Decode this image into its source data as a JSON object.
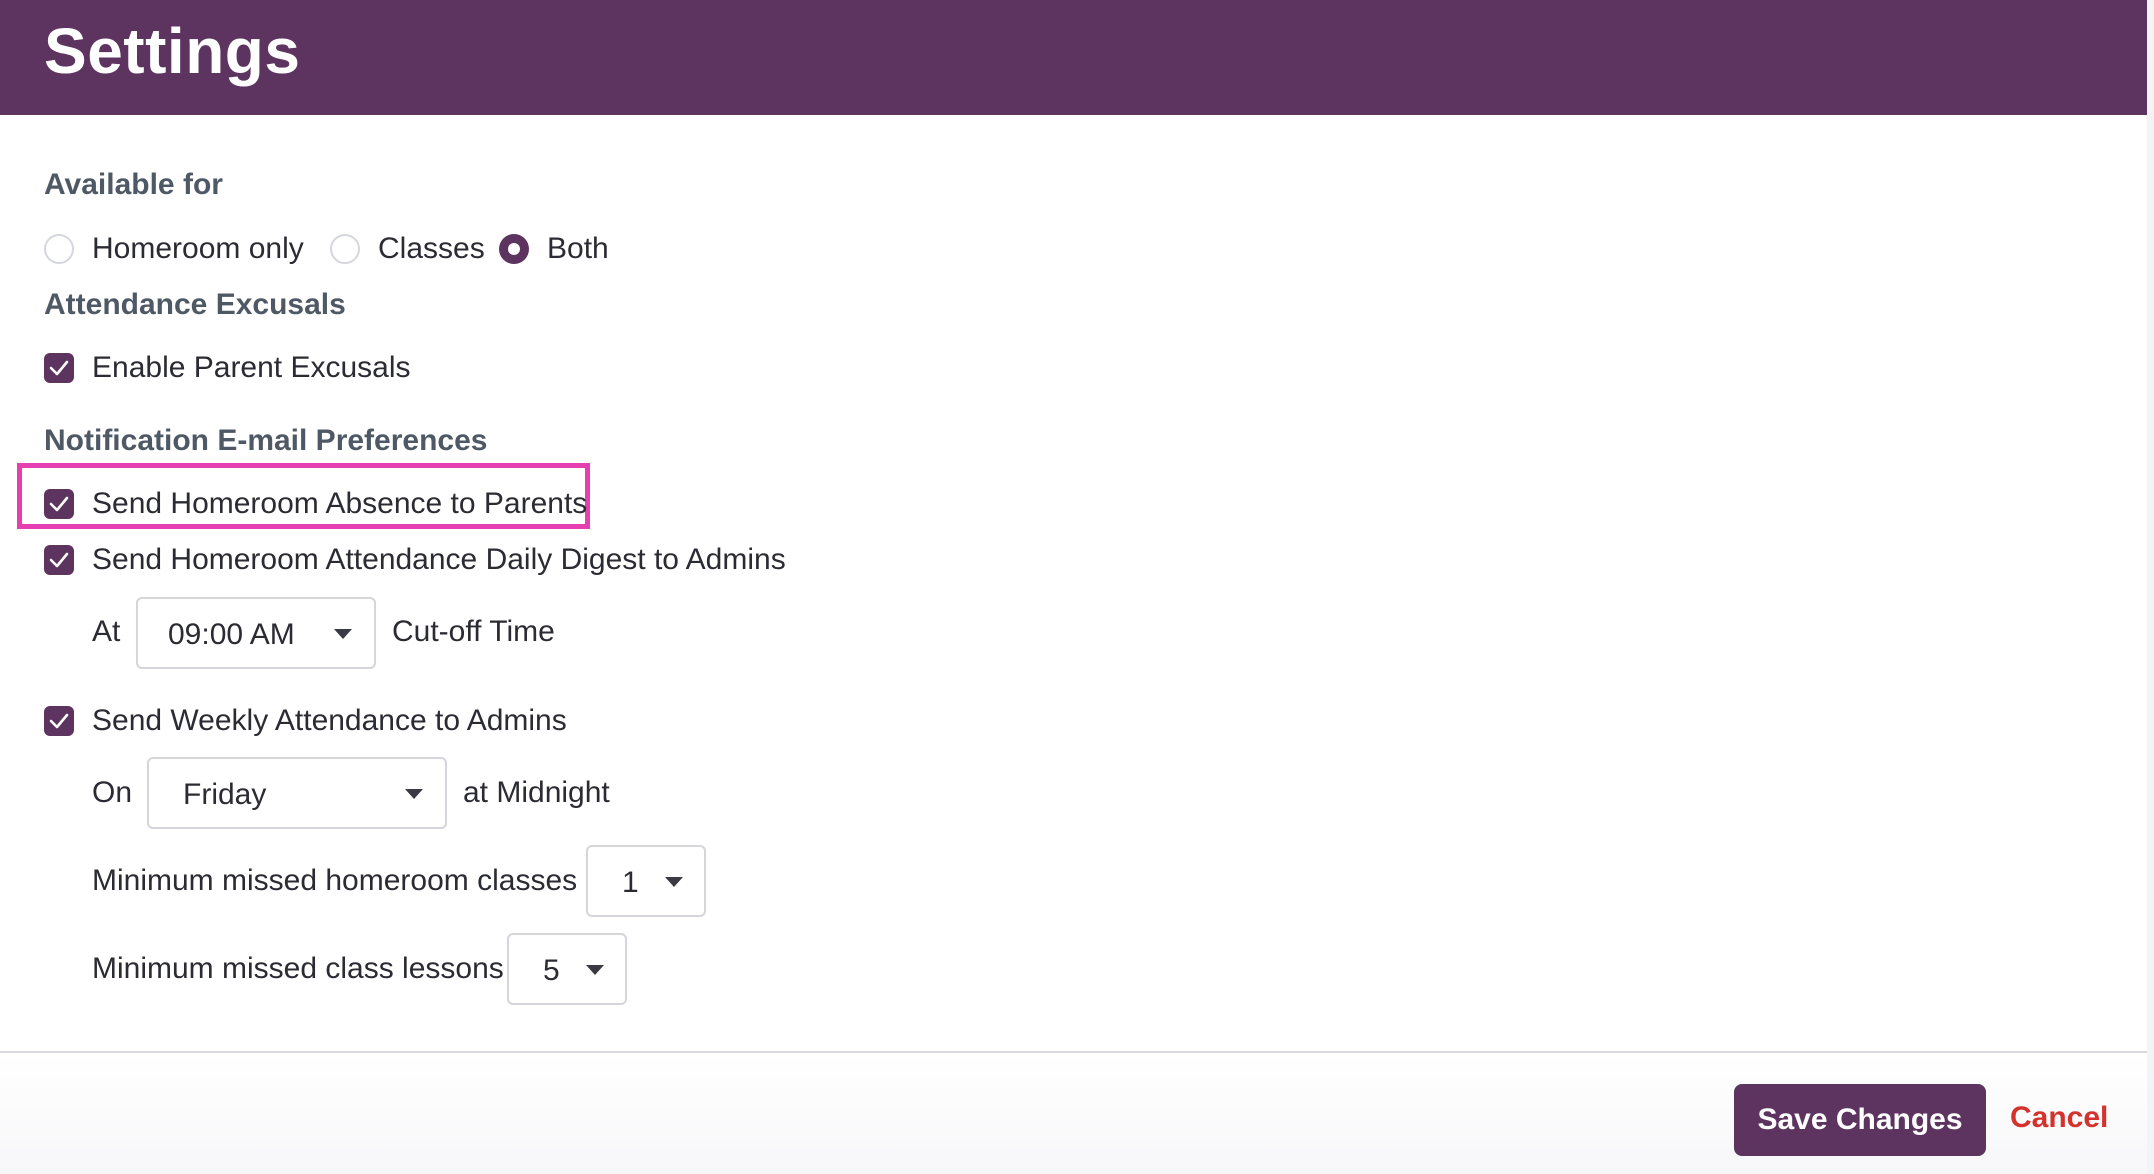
{
  "header": {
    "title": "Settings"
  },
  "available_for": {
    "label": "Available for",
    "options": [
      "Homeroom only",
      "Classes",
      "Both"
    ],
    "selected": "Both"
  },
  "attendance_excusals": {
    "label": "Attendance Excusals",
    "enable_parent_excusals": {
      "label": "Enable Parent Excusals",
      "checked": true
    }
  },
  "notifications": {
    "label": "Notification E-mail Preferences",
    "homeroom_absence": {
      "label": "Send Homeroom Absence to Parents",
      "checked": true
    },
    "daily_digest": {
      "label": "Send Homeroom Attendance Daily Digest to Admins",
      "checked": true,
      "at_label": "At",
      "time": "09:00 AM",
      "cutoff_label": "Cut-off Time"
    },
    "weekly": {
      "label": "Send Weekly Attendance to Admins",
      "checked": true,
      "on_label": "On",
      "day": "Friday",
      "midnight_label": "at Midnight",
      "min_homeroom_label": "Minimum missed homeroom classes",
      "min_homeroom_value": "1",
      "min_class_label": "Minimum missed class lessons",
      "min_class_value": "5"
    }
  },
  "footer": {
    "save_label": "Save Changes",
    "cancel_label": "Cancel"
  },
  "colors": {
    "brand": "#5d3360",
    "highlight": "#e53fb2",
    "cancel": "#d4322c"
  }
}
